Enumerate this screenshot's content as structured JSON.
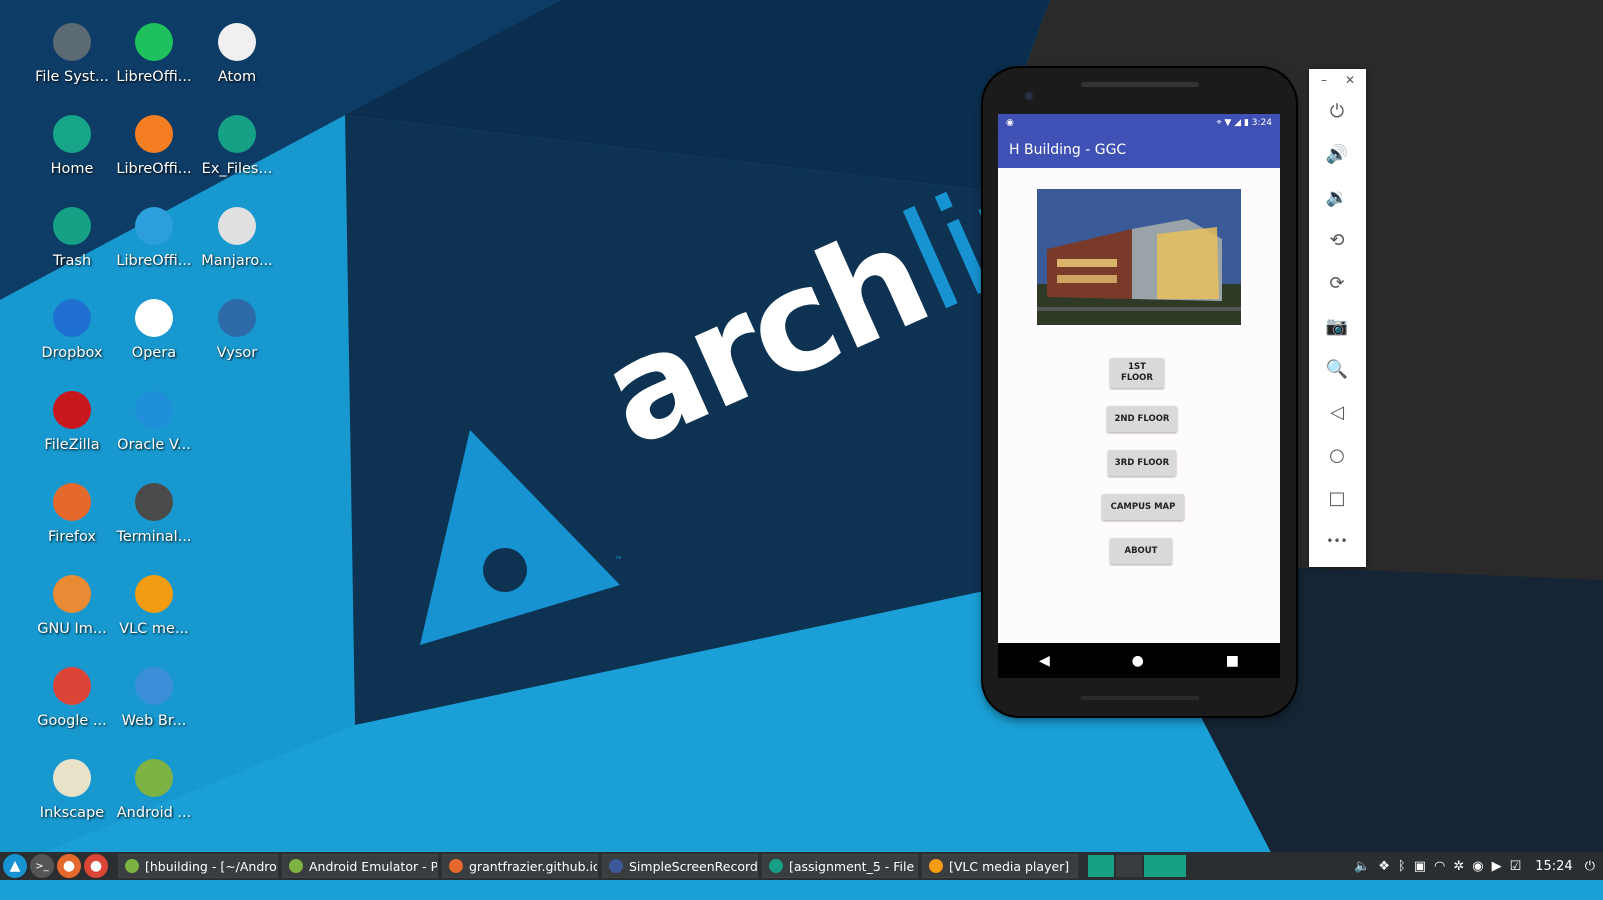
{
  "desktop_icons": [
    {
      "label": "File Syst...",
      "icon": "file-system-icon",
      "color": "#5c6a74"
    },
    {
      "label": "LibreOffi...",
      "icon": "libreoffice-calc-icon",
      "color": "#1ec15e"
    },
    {
      "label": "Atom",
      "icon": "atom-icon",
      "color": "#f0f0f0"
    },
    {
      "label": "Home",
      "icon": "home-folder-icon",
      "color": "#17a589"
    },
    {
      "label": "LibreOffi...",
      "icon": "libreoffice-impress-icon",
      "color": "#f57e22"
    },
    {
      "label": "Ex_Files...",
      "icon": "folder-icon",
      "color": "#16a085"
    },
    {
      "label": "Trash",
      "icon": "trash-icon",
      "color": "#16a085"
    },
    {
      "label": "LibreOffi...",
      "icon": "libreoffice-writer-icon",
      "color": "#2d9fdc"
    },
    {
      "label": "Manjaro...",
      "icon": "manjaro-settings-icon",
      "color": "#e0e0e0"
    },
    {
      "label": "Dropbox",
      "icon": "dropbox-icon",
      "color": "#1f6fd0"
    },
    {
      "label": "Opera",
      "icon": "opera-icon",
      "color": "#ffffff"
    },
    {
      "label": "Vysor",
      "icon": "vysor-icon",
      "color": "#2d6aa8"
    },
    {
      "label": "FileZilla",
      "icon": "filezilla-icon",
      "color": "#c9171e"
    },
    {
      "label": "Oracle V...",
      "icon": "virtualbox-icon",
      "color": "#1e8fd8"
    },
    {
      "label": "Firefox",
      "icon": "firefox-icon",
      "color": "#e5682c"
    },
    {
      "label": "Terminal...",
      "icon": "terminal-icon",
      "color": "#4a4a4a"
    },
    {
      "label": "GNU Im...",
      "icon": "gimp-icon",
      "color": "#e98b34"
    },
    {
      "label": "VLC me...",
      "icon": "vlc-icon",
      "color": "#f39c12"
    },
    {
      "label": "Google ...",
      "icon": "chrome-icon",
      "color": "#db4437"
    },
    {
      "label": "Web Br...",
      "icon": "web-browser-icon",
      "color": "#3b8fd8"
    },
    {
      "label": "Inkscape",
      "icon": "inkscape-icon",
      "color": "#e8e2c8"
    },
    {
      "label": "Android ...",
      "icon": "android-studio-icon",
      "color": "#7cb342"
    }
  ],
  "wallpaper": {
    "text_bold": "arch",
    "text_light": "linu",
    "tm": "™"
  },
  "phone": {
    "status_time": "3:24",
    "app_title": "H Building - GGC",
    "buttons": [
      {
        "label": "1ST FLOOR"
      },
      {
        "label": "2ND FLOOR"
      },
      {
        "label": "3RD FLOOR"
      },
      {
        "label": "CAMPUS MAP"
      },
      {
        "label": "ABOUT"
      }
    ],
    "nav": {
      "back": "◀",
      "home": "●",
      "recents": "■"
    }
  },
  "emulator_toolbar": {
    "minimize": "–",
    "close": "✕",
    "buttons": [
      {
        "name": "power-icon",
        "glyph": "⏻"
      },
      {
        "name": "volume-up-icon",
        "glyph": "🔊"
      },
      {
        "name": "volume-down-icon",
        "glyph": "🔉"
      },
      {
        "name": "rotate-left-icon",
        "glyph": "⟲"
      },
      {
        "name": "rotate-right-icon",
        "glyph": "⟳"
      },
      {
        "name": "camera-icon",
        "glyph": "📷"
      },
      {
        "name": "zoom-icon",
        "glyph": "🔍"
      },
      {
        "name": "back-icon",
        "glyph": "◁"
      },
      {
        "name": "home-icon",
        "glyph": "○"
      },
      {
        "name": "overview-icon",
        "glyph": "□"
      },
      {
        "name": "more-icon",
        "glyph": "•••"
      }
    ]
  },
  "taskbar": {
    "launchers": [
      {
        "name": "start-menu-icon",
        "glyph": "▲",
        "color": "#1793d1"
      },
      {
        "name": "terminal-launcher-icon",
        "glyph": ">_",
        "color": "#555"
      },
      {
        "name": "firefox-launcher-icon",
        "glyph": "●",
        "color": "#e5682c"
      },
      {
        "name": "chrome-launcher-icon",
        "glyph": "●",
        "color": "#db4437"
      }
    ],
    "tasks": [
      {
        "label": "[hbuilding - [~/Androi...",
        "color": "#7cb342",
        "width": 160
      },
      {
        "label": "Android Emulator - P...",
        "color": "#7cb342",
        "width": 156
      },
      {
        "label": "grantfrazier.github.io...",
        "color": "#e5682c",
        "width": 156
      },
      {
        "label": "SimpleScreenRecorder",
        "color": "#3b5998",
        "width": 156
      },
      {
        "label": "[assignment_5 - File ...",
        "color": "#16a085",
        "width": 156
      },
      {
        "label": "[VLC media player]",
        "color": "#f39c12",
        "width": 156
      }
    ],
    "clock": "15:24"
  }
}
